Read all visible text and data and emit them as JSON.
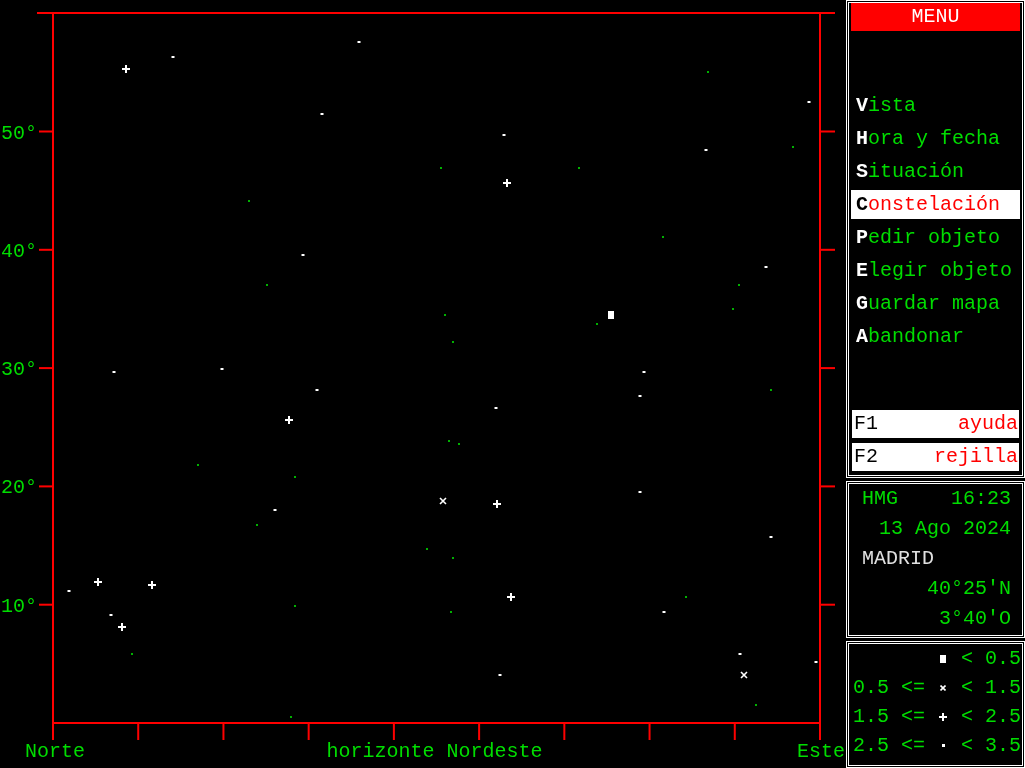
{
  "sky_chart": {
    "altitude_labels": [
      "50°",
      "40°",
      "30°",
      "20°",
      "10°"
    ],
    "left_label": "Norte",
    "horizon_title": "horizonte Nordeste",
    "right_label": "Este"
  },
  "menu": {
    "title": "MENU",
    "items": [
      {
        "label": "**V**ista",
        "selected": false
      },
      {
        "label": "**H**ora y fecha",
        "selected": false
      },
      {
        "label": "**S**ituación",
        "selected": false
      },
      {
        "label": "**C**onstelación",
        "selected": true
      },
      {
        "label": "**P**edir objeto",
        "selected": false
      },
      {
        "label": "**E**legir objeto",
        "selected": false
      },
      {
        "label": "**G**uardar mapa",
        "selected": false
      },
      {
        "label": "**A**bandonar",
        "selected": false
      }
    ]
  },
  "function_keys": [
    {
      "key": "F1",
      "label": "ayuda"
    },
    {
      "key": "F2",
      "label": "rejilla"
    }
  ],
  "location": {
    "timezone": "HMG",
    "time": "16:23",
    "date": "13 Ago 2024",
    "city": "MADRID",
    "latitude": "40°25'N",
    "longitude": "3°40'O"
  },
  "legend": [
    {
      "kind": "square",
      "upper": "< 0.5"
    },
    {
      "lower": "0.5 <=",
      "kind": "cross",
      "upper": "< 1.5"
    },
    {
      "lower": "1.5 <=",
      "kind": "plus",
      "upper": "< 2.5"
    },
    {
      "lower": "2.5 <=",
      "kind": "dot",
      "upper": "< 3.5"
    }
  ]
}
